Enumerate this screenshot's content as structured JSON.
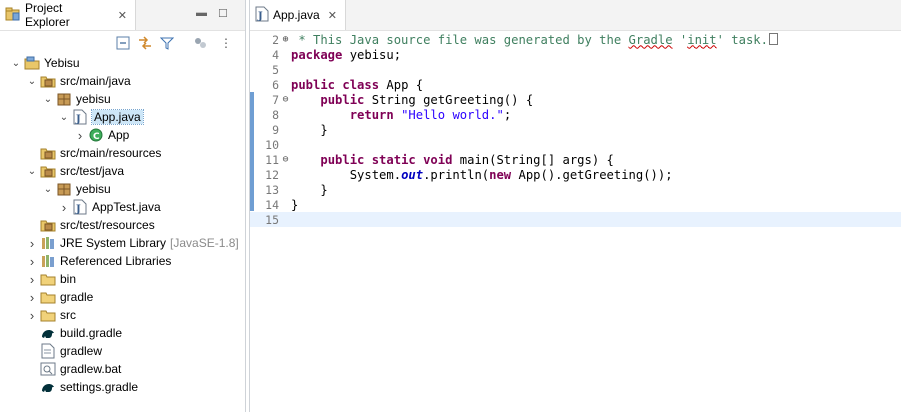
{
  "explorer": {
    "tab_label": "Project Explorer",
    "tree": [
      {
        "label": "Yebisu",
        "level": 0,
        "chev": "open",
        "icon": "project-icon"
      },
      {
        "label": "src/main/java",
        "level": 1,
        "chev": "open",
        "icon": "source-folder-icon"
      },
      {
        "label": "yebisu",
        "level": 2,
        "chev": "open",
        "icon": "package-icon"
      },
      {
        "label": "App.java",
        "level": 3,
        "chev": "open",
        "icon": "java-file-icon",
        "selected": true
      },
      {
        "label": "App",
        "level": 4,
        "chev": "closed",
        "icon": "class-icon"
      },
      {
        "label": "src/main/resources",
        "level": 1,
        "chev": "none",
        "icon": "source-folder-icon"
      },
      {
        "label": "src/test/java",
        "level": 1,
        "chev": "open",
        "icon": "source-folder-icon"
      },
      {
        "label": "yebisu",
        "level": 2,
        "chev": "open",
        "icon": "package-icon"
      },
      {
        "label": "AppTest.java",
        "level": 3,
        "chev": "closed",
        "icon": "java-file-icon"
      },
      {
        "label": "src/test/resources",
        "level": 1,
        "chev": "none",
        "icon": "source-folder-icon"
      },
      {
        "label": "JRE System Library",
        "decoration": "[JavaSE-1.8]",
        "level": 1,
        "chev": "closed",
        "icon": "library-icon"
      },
      {
        "label": "Referenced Libraries",
        "level": 1,
        "chev": "closed",
        "icon": "library-icon"
      },
      {
        "label": "bin",
        "level": 1,
        "chev": "closed",
        "icon": "folder-icon"
      },
      {
        "label": "gradle",
        "level": 1,
        "chev": "closed",
        "icon": "folder-icon"
      },
      {
        "label": "src",
        "level": 1,
        "chev": "closed",
        "icon": "folder-icon"
      },
      {
        "label": "build.gradle",
        "level": 1,
        "chev": "none",
        "icon": "gradle-file-icon"
      },
      {
        "label": "gradlew",
        "level": 1,
        "chev": "none",
        "icon": "text-file-icon"
      },
      {
        "label": "gradlew.bat",
        "level": 1,
        "chev": "none",
        "icon": "bat-file-icon"
      },
      {
        "label": "settings.gradle",
        "level": 1,
        "chev": "none",
        "icon": "gradle-file-icon"
      }
    ]
  },
  "editor": {
    "tab_label": "App.java",
    "lines": [
      {
        "num": "2",
        "fold": "+",
        "html": "<span class=\"cmt\"> * This Java source file was generated by the <span class=\"squig\">Gradle</span> '<span class=\"squig\">init</span>' task.</span><span class=\"box\"></span>"
      },
      {
        "num": "4",
        "html": "<span class=\"kw\">package</span> yebisu;"
      },
      {
        "num": "5",
        "html": ""
      },
      {
        "num": "6",
        "html": "<span class=\"kw\">public class</span> App {"
      },
      {
        "num": "7",
        "fold": "-",
        "html": "    <span class=\"kw\">public</span> String getGreeting() {"
      },
      {
        "num": "8",
        "html": "        <span class=\"kw\">return</span> <span class=\"str\">\"Hello world.\"</span>;"
      },
      {
        "num": "9",
        "html": "    }"
      },
      {
        "num": "10",
        "html": ""
      },
      {
        "num": "11",
        "fold": "-",
        "html": "    <span class=\"kw\">public static void</span> main(String[] args) {"
      },
      {
        "num": "12",
        "html": "        System.<span class=\"static\">out</span>.println(<span class=\"kw\">new</span> App().getGreeting());"
      },
      {
        "num": "13",
        "html": "    }"
      },
      {
        "num": "14",
        "html": "}"
      },
      {
        "num": "15",
        "html": "",
        "current": true
      }
    ]
  }
}
